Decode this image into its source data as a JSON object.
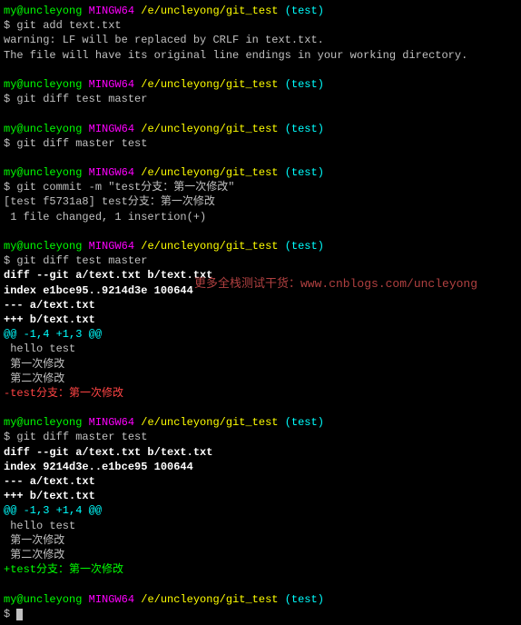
{
  "prompt": {
    "user": "my@uncleyong",
    "host": "MINGW64",
    "path": "/e/uncleyong/git_test",
    "branch": "(test)",
    "sym": "$"
  },
  "b1": {
    "cmd": "git add text.txt",
    "out1": "warning: LF will be replaced by CRLF in text.txt.",
    "out2": "The file will have its original line endings in your working directory."
  },
  "b2": {
    "cmd": "git diff test master"
  },
  "b3": {
    "cmd": "git diff master test"
  },
  "b4": {
    "cmd": "git commit -m \"test分支：第一次修改\"",
    "out1": "[test f5731a8] test分支：第一次修改",
    "out2": " 1 file changed, 1 insertion(+)"
  },
  "b5": {
    "cmd": "git diff test master",
    "d1": "diff --git a/text.txt b/text.txt",
    "d2": "index e1bce95..9214d3e 100644",
    "d3": "--- a/text.txt",
    "d4": "+++ b/text.txt",
    "hunk": "@@ -1,4 +1,3 @@",
    "l1": " hello test",
    "l2": " 第一次修改",
    "l3": " 第二次修改",
    "rem": "-test分支：第一次修改"
  },
  "b6": {
    "cmd": "git diff master test",
    "d1": "diff --git a/text.txt b/text.txt",
    "d2": "index 9214d3e..e1bce95 100644",
    "d3": "--- a/text.txt",
    "d4": "+++ b/text.txt",
    "hunk": "@@ -1,3 +1,4 @@",
    "l1": " hello test",
    "l2": " 第一次修改",
    "l3": " 第二次修改",
    "add": "+test分支：第一次修改"
  },
  "watermark": "更多全栈测试干货：www.cnblogs.com/uncleyong"
}
